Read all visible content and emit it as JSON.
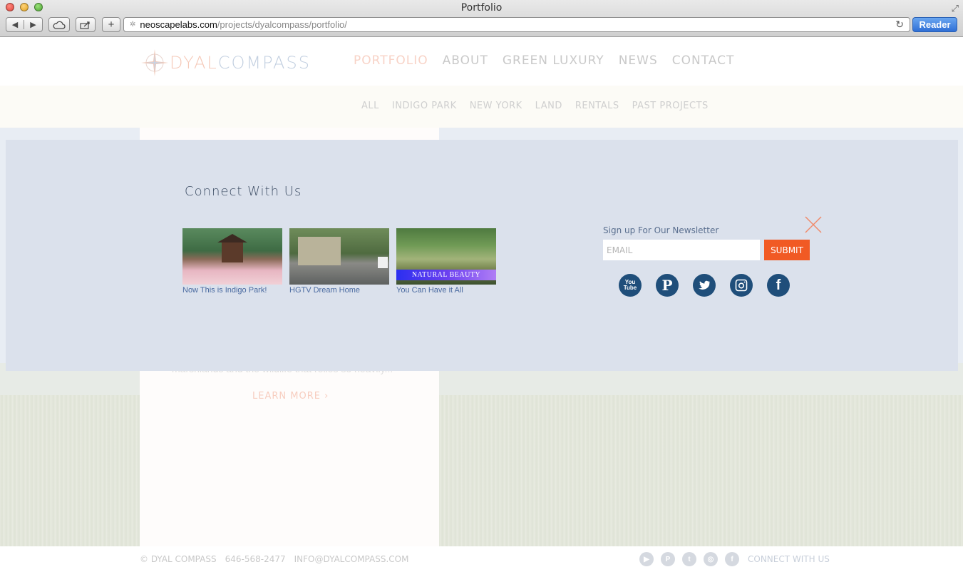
{
  "browser": {
    "title": "Portfolio",
    "url_host": "neoscapelabs.com",
    "url_path": "/projects/dyalcompass/portfolio/",
    "reader_label": "Reader"
  },
  "site": {
    "logo_part1": "DYAL",
    "logo_part2": "COMPASS",
    "main_nav": [
      "PORTFOLIO",
      "ABOUT",
      "GREEN LUXURY",
      "NEWS",
      "CONTACT"
    ],
    "sub_nav": [
      "ALL",
      "INDIGO PARK",
      "NEW YORK",
      "LAND",
      "RENTALS",
      "PAST PROJECTS"
    ],
    "card_text": "marshlands and the wildlife that relies so heavily...",
    "learn_more": "LEARN MORE ›"
  },
  "modal": {
    "heading": "Connect With Us",
    "videos": [
      {
        "caption": "Now This is Indigo Park!"
      },
      {
        "caption": "HGTV Dream Home"
      },
      {
        "caption": "You Can Have it All",
        "banner": "NATURAL BEAUTY"
      }
    ],
    "newsletter_label": "Sign up For Our Newsletter",
    "email_placeholder": "EMAIL",
    "submit_label": "SUBMIT",
    "social": [
      {
        "icon": "youtube-icon",
        "glyph": "You Tube"
      },
      {
        "icon": "pinterest-icon",
        "glyph": "P"
      },
      {
        "icon": "twitter-icon",
        "glyph": "t"
      },
      {
        "icon": "instagram-icon",
        "glyph": "◎"
      },
      {
        "icon": "facebook-icon",
        "glyph": "f"
      }
    ]
  },
  "footer": {
    "copyright": "© DYAL COMPASS",
    "phone": "646-568-2477",
    "email": "INFO@DYALCOMPASS.COM",
    "connect": "CONNECT WITH US"
  },
  "colors": {
    "accent_orange": "#f15a24",
    "social_blue": "#1f4e7a",
    "modal_bg": "#dbe1ec"
  }
}
